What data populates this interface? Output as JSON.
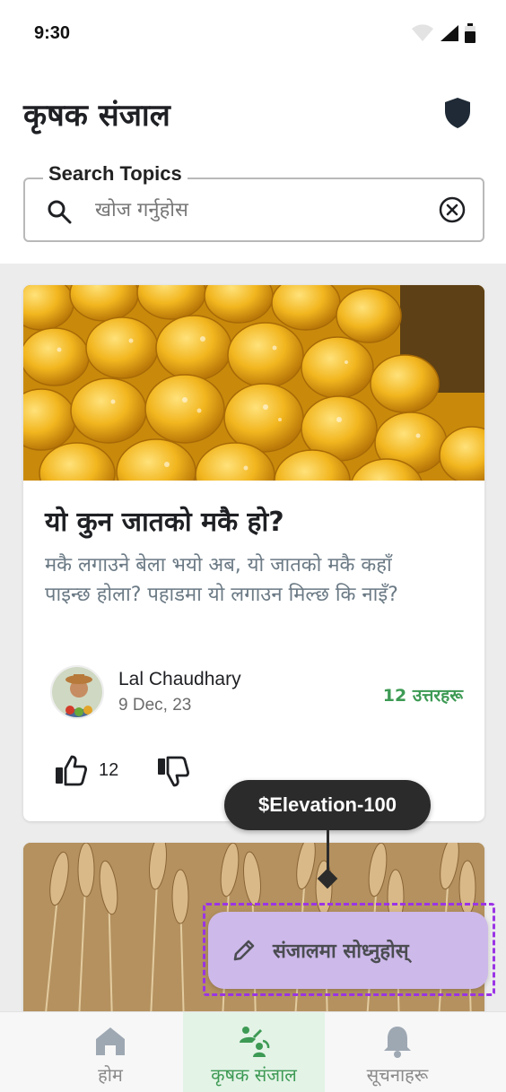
{
  "status_bar": {
    "time": "9:30"
  },
  "header": {
    "title": "कृषक संजाल"
  },
  "search": {
    "label": "Search Topics",
    "placeholder": "खोज गर्नुहोस"
  },
  "posts": [
    {
      "title": "यो कुन जातको मकै हो?",
      "body": "मकै लगाउने बेला भयो अब, यो जातको मकै कहाँ पाइन्छ होला? पहाडमा यो लगाउन मिल्छ कि नाइँ?",
      "author": "Lal Chaudhary",
      "date": "9 Dec, 23",
      "answers": "12 उत्तरहरू",
      "likes": "12"
    }
  ],
  "tooltip": {
    "text": "$Elevation-100"
  },
  "fab": {
    "label": "संजालमा सोध्नुहोस्"
  },
  "bottom_nav": {
    "items": [
      {
        "label": "होम",
        "icon": "home-icon"
      },
      {
        "label": "कृषक संजाल",
        "icon": "farmer-network-icon"
      },
      {
        "label": "सूचनाहरू",
        "icon": "bell-icon"
      }
    ],
    "active_index": 1
  },
  "colors": {
    "accent_green": "#3d9a54",
    "fab_bg": "#cdb9ea",
    "outline_purple": "#9b34e6"
  }
}
